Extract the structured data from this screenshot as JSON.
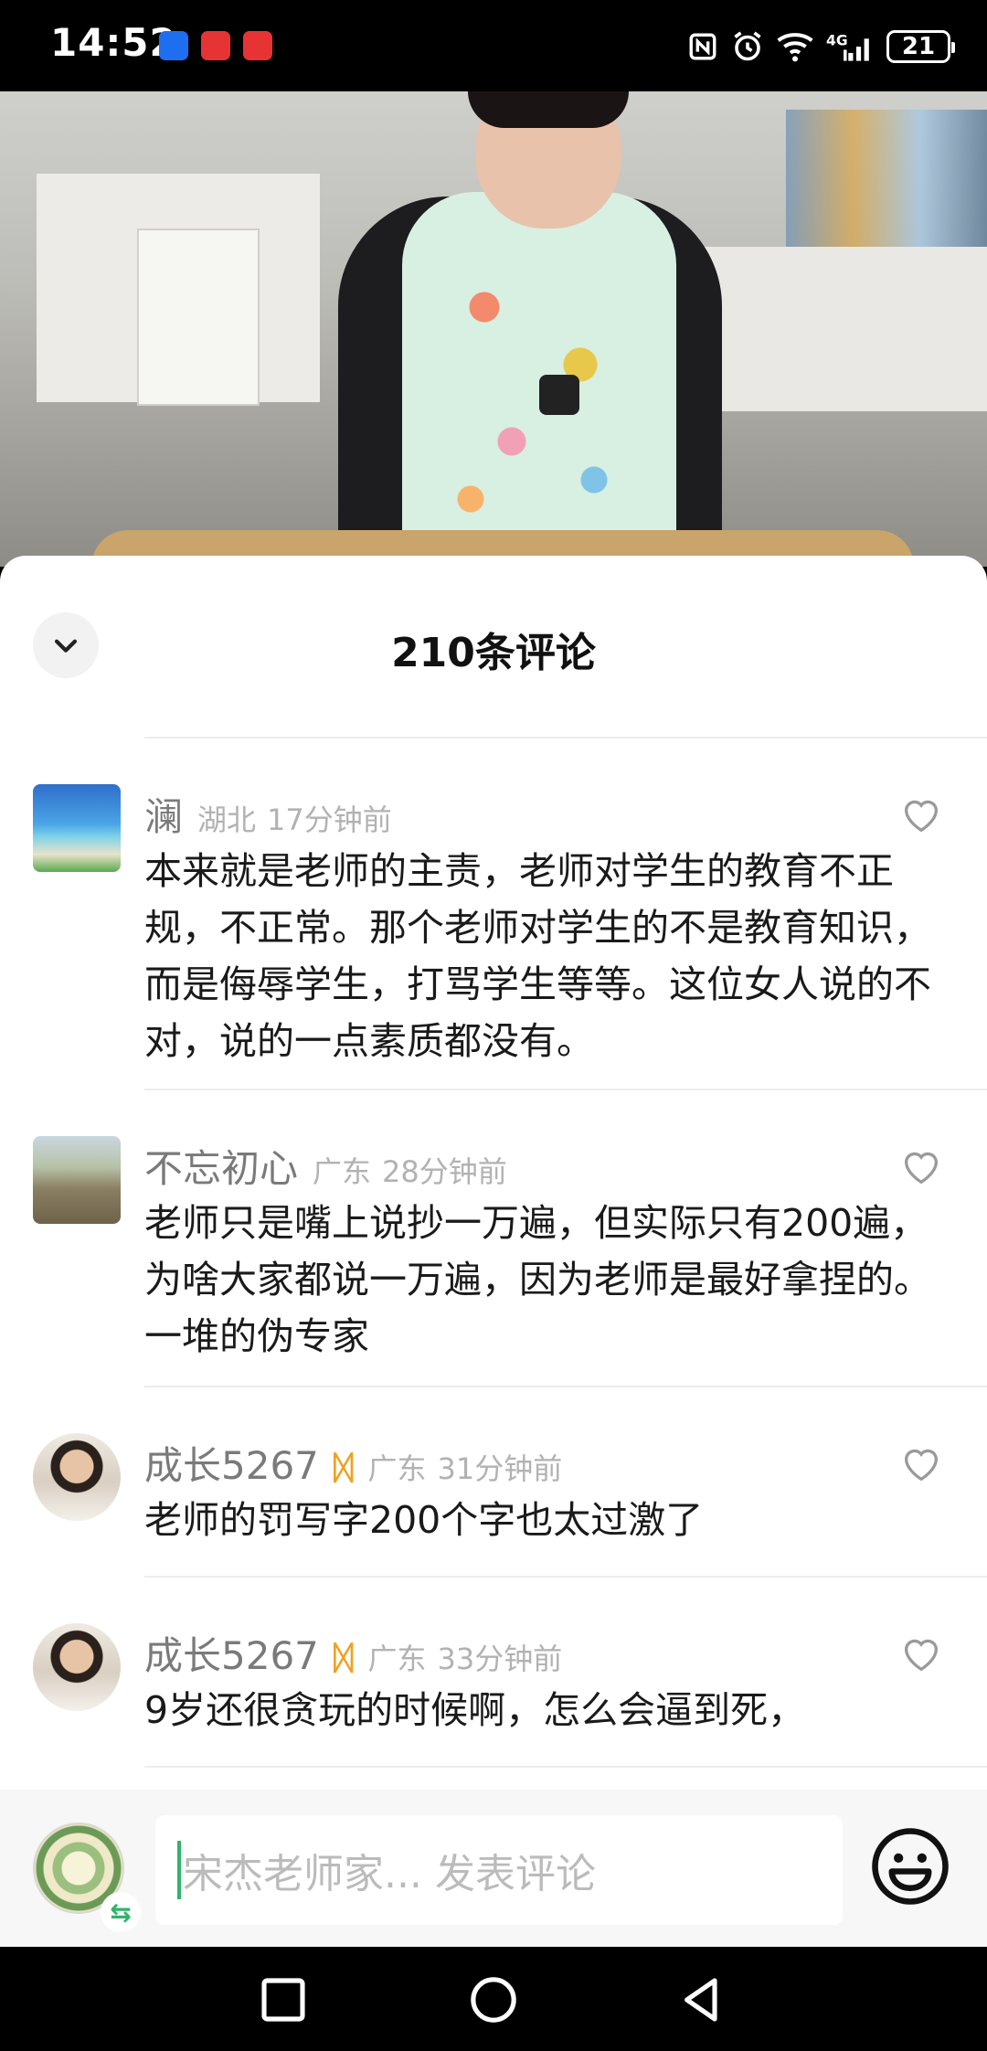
{
  "status_bar": {
    "time": "14:52",
    "battery": "21",
    "icons": [
      "nfc-icon",
      "alarm-icon",
      "wifi-icon",
      "4g-signal-icon"
    ]
  },
  "video": {
    "description": "teacher-video-frame"
  },
  "comments_panel": {
    "title": "210条评论",
    "comments": [
      {
        "name": "澜",
        "location": "湖北",
        "time": "17分钟前",
        "text": "本来就是老师的主责，老师对学生的教育不正规，不正常。那个老师对学生的不是教育知识，而是侮辱学生，打骂学生等等。这位女人说的不对，说的一点素质都没有。"
      },
      {
        "name": "不忘初心",
        "location": "广东",
        "time": "28分钟前",
        "text": "老师只是嘴上说抄一万遍，但实际只有200遍，为啥大家都说一万遍，因为老师是最好拿捏的。一堆的伪专家"
      },
      {
        "name": "成长5267",
        "location": "广东",
        "time": "31分钟前",
        "text": "老师的罚写字200个字也太过激了"
      },
      {
        "name": "成长5267",
        "location": "广东",
        "time": "33分钟前",
        "text": "9岁还很贪玩的时候啊，怎么会逼到死，"
      }
    ]
  },
  "input_bar": {
    "placeholder": "宋杰老师家... 发表评论"
  },
  "colors": {
    "accent_green": "#2fb46b",
    "badge_orange": "#f0a020",
    "meta_gray": "#b2b2b2"
  }
}
